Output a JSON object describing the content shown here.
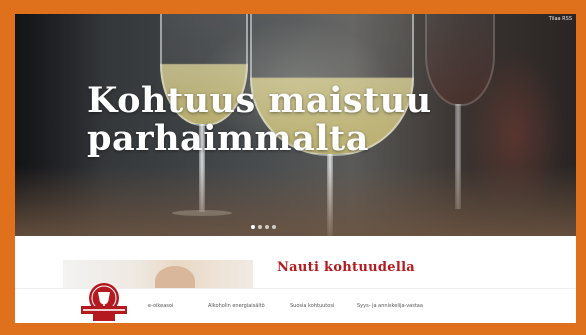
{
  "hero": {
    "title_line1": "Kohtuus maistuu",
    "title_line2": "parhaimmalta",
    "top_right_text": "Tilaa RSS",
    "carousel_count": 4
  },
  "section": {
    "title": "Nauti kohtuudella"
  },
  "nav": {
    "items": [
      "e-oikeasoi",
      "Alkoholin energiaisältö",
      "Suosia kohtuutosi",
      "Syys- ja anniskelija-vastaa"
    ]
  },
  "colors": {
    "frame": "#e0711c",
    "accent": "#b3191e"
  }
}
